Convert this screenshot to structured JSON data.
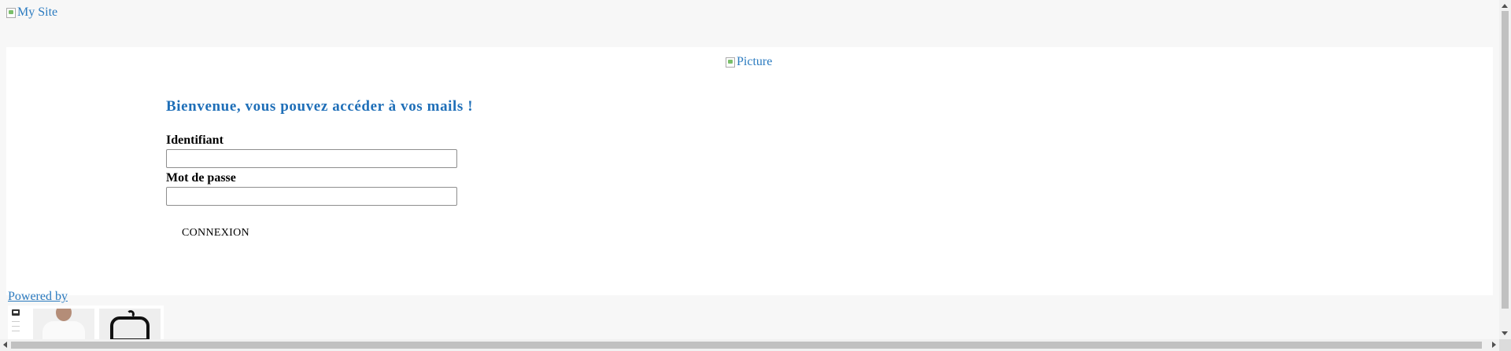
{
  "header": {
    "logo_alt": "My Site"
  },
  "main": {
    "picture_alt": "Picture",
    "welcome": "Bienvenue, vous pouvez accéder à vos mails !",
    "login": {
      "username_label": "Identifiant",
      "username_value": "",
      "password_label": "Mot de passe",
      "password_value": "",
      "submit_label": "CONNEXION"
    }
  },
  "footer": {
    "powered_by": "Powered by"
  },
  "colors": {
    "link": "#2b7bc0",
    "heading": "#1f6fb8",
    "background": "#f7f7f7",
    "panel": "#ffffff"
  },
  "icons": [
    "broken-image-icon",
    "chat-icon",
    "scroll-up-icon",
    "scroll-down-icon",
    "scroll-left-icon",
    "scroll-right-icon"
  ]
}
